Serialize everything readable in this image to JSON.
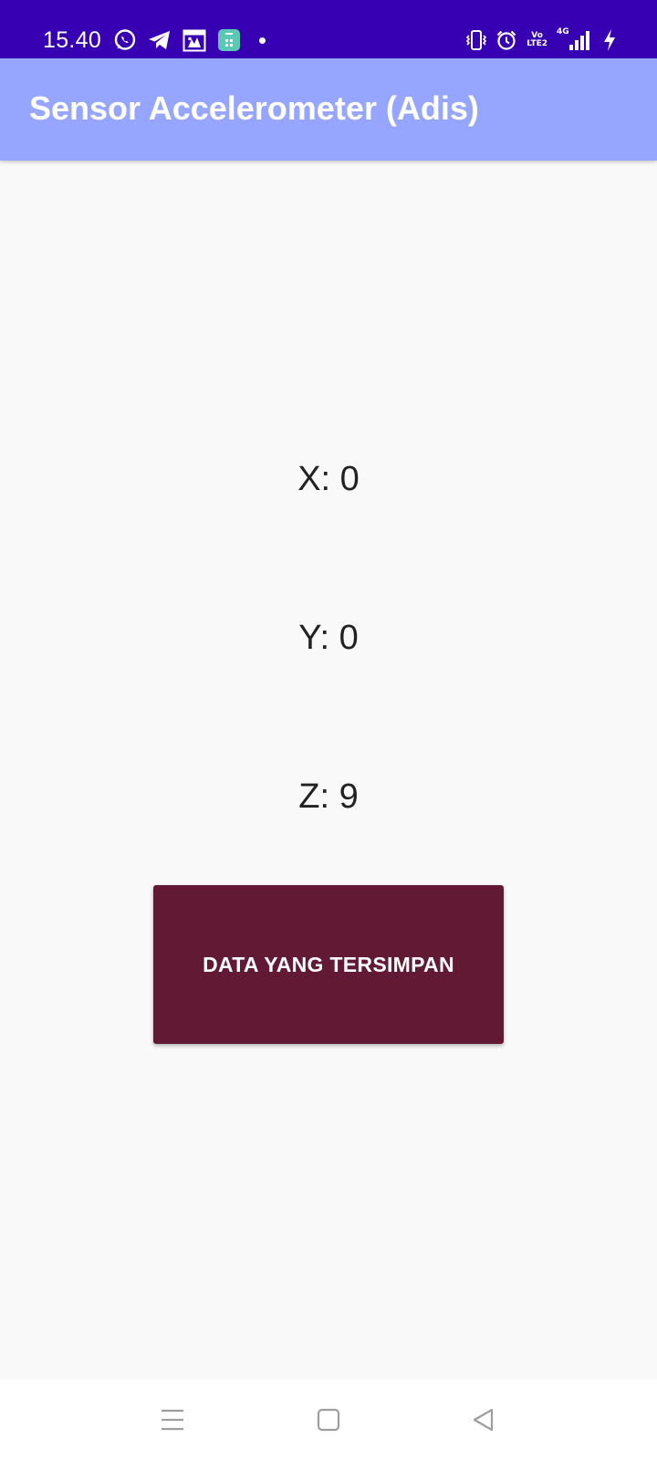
{
  "status_bar": {
    "time": "15.40",
    "background": "#3700b3",
    "left_icons": [
      "whatsapp-icon",
      "telegram-icon",
      "calendar-app-icon",
      "teal-app-icon",
      "notification-dot-icon"
    ],
    "right_icons": [
      "vibrate-icon",
      "alarm-icon",
      "volte-icon",
      "signal-4g-icon",
      "charging-icon"
    ],
    "volte_label_top": "Vo",
    "volte_label_bottom": "LTE2",
    "network_label": "4G"
  },
  "app_bar": {
    "title": "Sensor Accelerometer (Adis)",
    "background": "#96a6ff"
  },
  "sensor": {
    "x_label": "X: 0",
    "y_label": "Y: 0",
    "z_label": "Z: 9"
  },
  "button": {
    "label": "DATA YANG TERSIMPAN",
    "color": "#621a34"
  },
  "nav_bar": {
    "icons": [
      "menu-icon",
      "home-icon",
      "back-icon"
    ]
  }
}
